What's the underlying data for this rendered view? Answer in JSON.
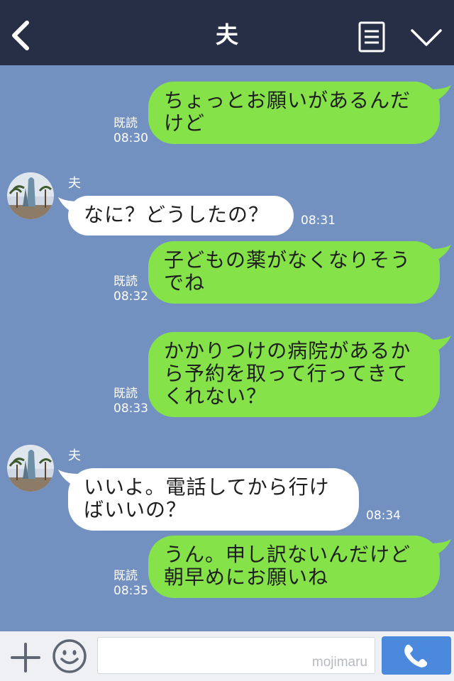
{
  "header": {
    "title": "夫"
  },
  "messages": [
    {
      "side": "sent",
      "text": "ちょっとお願いがあるんだけど",
      "lines": [
        "ちょっとお願いがあるんだ",
        "けど"
      ],
      "read": "既読",
      "time": "08:30"
    },
    {
      "side": "recv",
      "sender": "夫",
      "text": "なに？どうしたの？",
      "lines": [
        "なに？どうしたの？"
      ],
      "time": "08:31"
    },
    {
      "side": "sent",
      "text": "子どもの薬がなくなりそうでね",
      "lines": [
        "子どもの薬がなくなりそう",
        "でね"
      ],
      "read": "既読",
      "time": "08:32"
    },
    {
      "side": "sent",
      "text": "かかりつけの病院があるから予約を取って行ってきてくれない？",
      "lines": [
        "かかりつけの病院があるか",
        "ら予約を取って行ってきて",
        "くれない？"
      ],
      "read": "既読",
      "time": "08:33"
    },
    {
      "side": "recv",
      "sender": "夫",
      "text": "いいよ。電話してから行けばいいの？",
      "lines": [
        "いいよ。電話してから行け",
        "ばいいの？"
      ],
      "time": "08:34"
    },
    {
      "side": "sent",
      "text": "うん。申し訳ないんだけど朝早めにお願いね",
      "lines": [
        "うん。申し訳ないんだけど",
        "朝早めにお願いね"
      ],
      "read": "既読",
      "time": "08:35"
    }
  ],
  "footer": {
    "watermark": "mojimaru"
  },
  "icons": {
    "back": "chevron-left-icon",
    "menu": "menu-icon",
    "collapse": "chevron-down-icon",
    "add": "plus-icon",
    "emoji": "smiley-icon",
    "call": "phone-icon"
  },
  "colors": {
    "header": "#272f46",
    "background": "#7391c0",
    "sent_bubble": "#85e249",
    "received_bubble": "#ffffff",
    "call_button": "#4a89dc"
  }
}
